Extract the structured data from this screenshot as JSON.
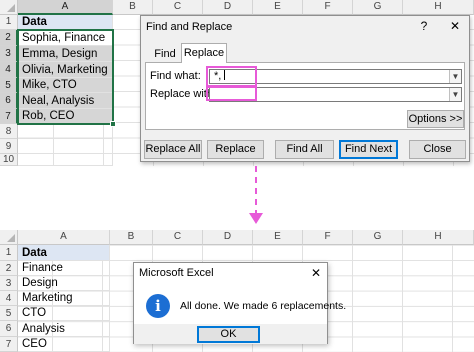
{
  "top_sheet": {
    "columns": [
      "A",
      "B",
      "C",
      "D",
      "E",
      "F",
      "G",
      "H"
    ],
    "rows": [
      "1",
      "2",
      "3",
      "4",
      "5",
      "6",
      "7",
      "8",
      "9",
      "10"
    ],
    "cells": [
      "Data",
      "Sophia, Finance",
      "Emma, Design",
      "Olivia, Marketing",
      "Mike, CTO",
      "Neal, Analysis",
      "Rob, CEO"
    ]
  },
  "find_replace": {
    "title": "Find and Replace",
    "help_icon": "?",
    "close_icon": "✕",
    "tabs": [
      "Find",
      "Replace"
    ],
    "active_tab": "Replace",
    "find_label": "Find what:",
    "find_value": "*, ",
    "replace_label": "Replace with:",
    "replace_value": "",
    "options_button": "Options >>",
    "buttons": {
      "replace_all": "Replace All",
      "replace": "Replace",
      "find_all": "Find All",
      "find_next": "Find Next",
      "close": "Close"
    }
  },
  "bottom_sheet": {
    "columns": [
      "A",
      "B",
      "C",
      "D",
      "E",
      "F",
      "G",
      "H"
    ],
    "rows": [
      "1",
      "2",
      "3",
      "4",
      "5",
      "6",
      "7"
    ],
    "cells": [
      "Data",
      "Finance",
      "Design",
      "Marketing",
      "CTO",
      "Analysis",
      "CEO"
    ]
  },
  "message_box": {
    "title": "Microsoft Excel",
    "close_icon": "✕",
    "info_icon": "i",
    "message": "All done. We made 6 replacements.",
    "ok_button": "OK"
  },
  "colors": {
    "excel_green": "#217346",
    "highlight_pink": "#e75ad8",
    "header_fill": "#dde6f3",
    "dialog_bg": "#f0f0f0",
    "default_button_border": "#0078d7",
    "info_blue": "#1c6ed3"
  }
}
